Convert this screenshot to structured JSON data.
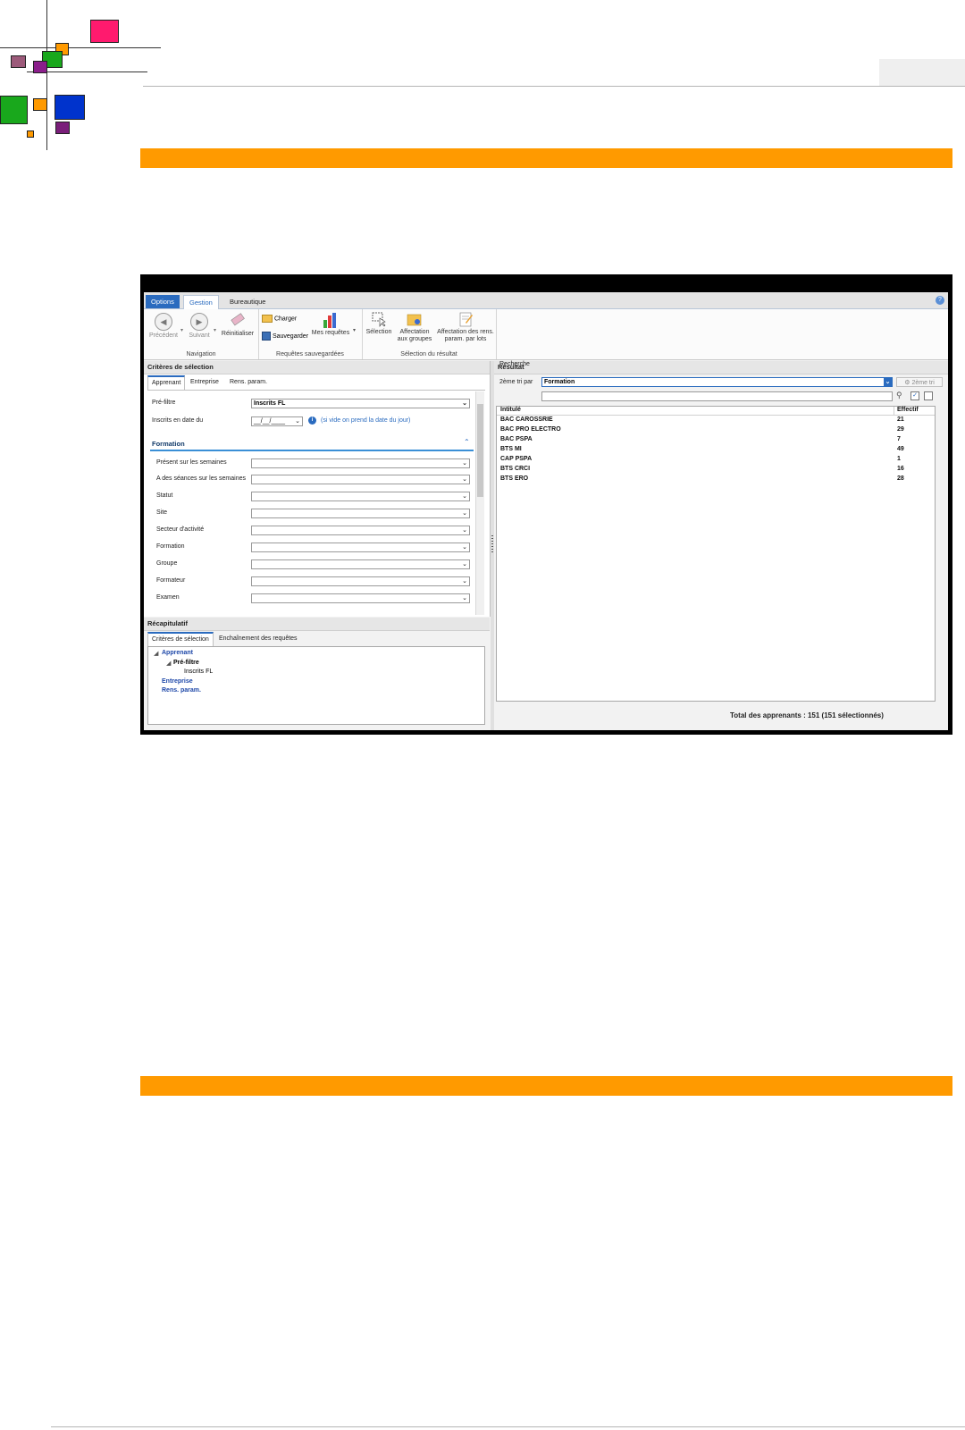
{
  "ribbon": {
    "tabs": [
      "Options",
      "Gestion",
      "Bureautique"
    ],
    "help_icon": "?",
    "groups": {
      "navigation": {
        "label": "Navigation",
        "buttons": [
          "Précédent",
          "Suivant",
          "Réinitialiser"
        ]
      },
      "requetes": {
        "label": "Requêtes sauvegardées",
        "charger": "Charger",
        "sauvegarder": "Sauvegarder",
        "mes_requetes": "Mes requêtes"
      },
      "selection": {
        "label": "Sélection du résultat",
        "selection": "Sélection",
        "affectation_line1": "Affectation",
        "affectation_line2": "aux groupes",
        "affect_rens_line1": "Affectation des rens.",
        "affect_rens_line2": "param. par lots"
      }
    }
  },
  "criteres": {
    "title": "Critères de sélection",
    "tabs": [
      "Apprenant",
      "Entreprise",
      "Rens. param."
    ],
    "prefiltre_label": "Pré-filtre",
    "prefiltre_value": "Inscrits FL",
    "inscrits_label": "Inscrits en date du",
    "date_value": "__/__/____",
    "date_hint": "(si vide on prend la date du jour)",
    "formation_section": "Formation",
    "fields": [
      "Présent sur les semaines",
      "A des séances sur les semaines",
      "Statut",
      "Site",
      "Secteur d'activité",
      "Formation",
      "Groupe",
      "Formateur",
      "Examen"
    ]
  },
  "recap": {
    "title": "Récapitulatif",
    "tabs": [
      "Critères de sélection",
      "Enchaînement des requêtes"
    ],
    "tree": {
      "apprenant": "Apprenant",
      "prefiltre": "Pré-filtre",
      "inscrits": "Inscrits FL",
      "entreprise": "Entreprise",
      "rens": "Rens. param."
    }
  },
  "resultat": {
    "title": "Résultat",
    "tri_label": "2ème tri par",
    "tri_value": "Formation",
    "tri_button": "2ème tri",
    "recherche_label": "Recherche",
    "col_intitule": "Intitulé",
    "col_effectif": "Effectif",
    "rows": [
      {
        "name": "BAC CAROSSRIE",
        "count": "21"
      },
      {
        "name": "BAC PRO ELECTRO",
        "count": "29"
      },
      {
        "name": "BAC PSPA",
        "count": "7"
      },
      {
        "name": "BTS MI",
        "count": "49"
      },
      {
        "name": "CAP PSPA",
        "count": "1"
      },
      {
        "name": "BTS CRCI",
        "count": "16"
      },
      {
        "name": "BTS ERO",
        "count": "28"
      }
    ],
    "total": "Total des apprenants : 151 (151 sélectionnés)"
  },
  "colors": {
    "orange_band": "#ff9a00",
    "accent_blue": "#2a6bbf"
  }
}
